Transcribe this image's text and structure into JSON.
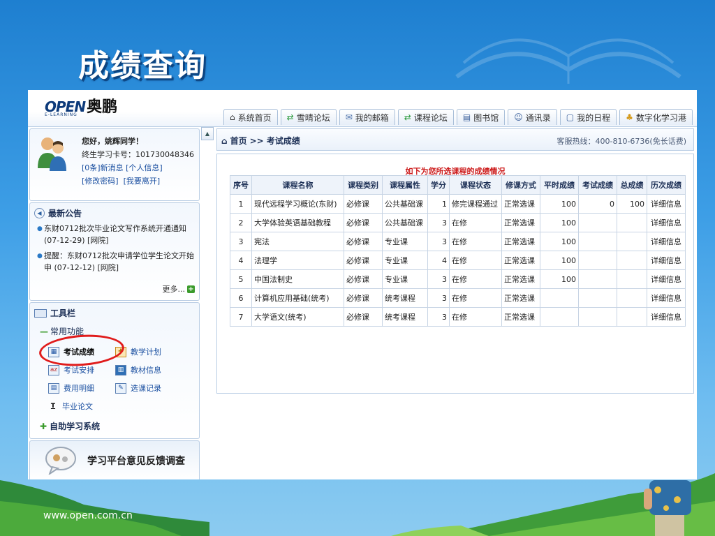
{
  "slide": {
    "title": "成绩查询",
    "footer_url": "www.open.com.cn"
  },
  "app": {
    "logo": {
      "brand": "OPEN",
      "name": "奥鹏",
      "sub": "E-LEARNING"
    },
    "nav_tabs": [
      {
        "label": "系统首页",
        "icon": "home-icon"
      },
      {
        "label": "雪晴论坛",
        "icon": "forum-icon"
      },
      {
        "label": "我的邮箱",
        "icon": "mail-icon"
      },
      {
        "label": "课程论坛",
        "icon": "forum-icon"
      },
      {
        "label": "图书馆",
        "icon": "book-icon"
      },
      {
        "label": "通讯录",
        "icon": "contacts-icon"
      },
      {
        "label": "我的日程",
        "icon": "calendar-icon"
      },
      {
        "label": "数字化学习港",
        "icon": "digital-icon"
      }
    ],
    "user": {
      "greeting": "您好，姚辉同学！",
      "card_label": "终生学习卡号：101730048346",
      "new_msg": "[0条]新消息",
      "profile": "[个人信息]",
      "change_pwd": "[修改密码]",
      "logout": "[我要离开]"
    },
    "notices": {
      "title": "最新公告",
      "items": [
        {
          "text": "东财0712批次毕业论文写作系统开通通知 (07-12-29) [网院]"
        },
        {
          "text": "提醒：东财0712批次申请学位学生论文开始申 (07-12-12) [网院]"
        }
      ],
      "more": "更多..."
    },
    "toolbar": {
      "title": "工具栏",
      "section": "常用功能",
      "items": [
        {
          "label": "考试成绩",
          "icon": "grade-icon"
        },
        {
          "label": "教学计划",
          "icon": "plan-icon"
        },
        {
          "label": "考试安排",
          "icon": "exam-schedule-icon"
        },
        {
          "label": "教材信息",
          "icon": "textbook-icon"
        },
        {
          "label": "费用明细",
          "icon": "fee-icon"
        },
        {
          "label": "选课记录",
          "icon": "course-record-icon"
        },
        {
          "label": "毕业论文",
          "icon": "thesis-icon"
        }
      ],
      "self_study": "自助学习系统"
    },
    "survey": {
      "label": "学习平台意见反馈调查"
    },
    "breadcrumb": {
      "home": "首页",
      "sep": ">>",
      "current": "考试成绩"
    },
    "hotline": "客服热线：400-810-6736(免长话费)",
    "table": {
      "caption": "如下为您所选课程的成绩情况",
      "headers": [
        "序号",
        "课程名称",
        "课程类别",
        "课程属性",
        "学分",
        "课程状态",
        "修课方式",
        "平时成绩",
        "考试成绩",
        "总成绩",
        "历次成绩"
      ],
      "rows": [
        [
          "1",
          "现代远程学习概论(东财)",
          "必修课",
          "公共基础课",
          "1",
          "修完课程通过",
          "正常选课",
          "100",
          "0",
          "100",
          "详细信息"
        ],
        [
          "2",
          "大学体验英语基础教程",
          "必修课",
          "公共基础课",
          "3",
          "在修",
          "正常选课",
          "100",
          "",
          "",
          "详细信息"
        ],
        [
          "3",
          "宪法",
          "必修课",
          "专业课",
          "3",
          "在修",
          "正常选课",
          "100",
          "",
          "",
          "详细信息"
        ],
        [
          "4",
          "法理学",
          "必修课",
          "专业课",
          "4",
          "在修",
          "正常选课",
          "100",
          "",
          "",
          "详细信息"
        ],
        [
          "5",
          "中国法制史",
          "必修课",
          "专业课",
          "3",
          "在修",
          "正常选课",
          "100",
          "",
          "",
          "详细信息"
        ],
        [
          "6",
          "计算机应用基础(统考)",
          "必修课",
          "统考课程",
          "3",
          "在修",
          "正常选课",
          "",
          "",
          "",
          "详细信息"
        ],
        [
          "7",
          "大学语文(统考)",
          "必修课",
          "统考课程",
          "3",
          "在修",
          "正常选课",
          "",
          "",
          "",
          "详细信息"
        ]
      ]
    }
  }
}
